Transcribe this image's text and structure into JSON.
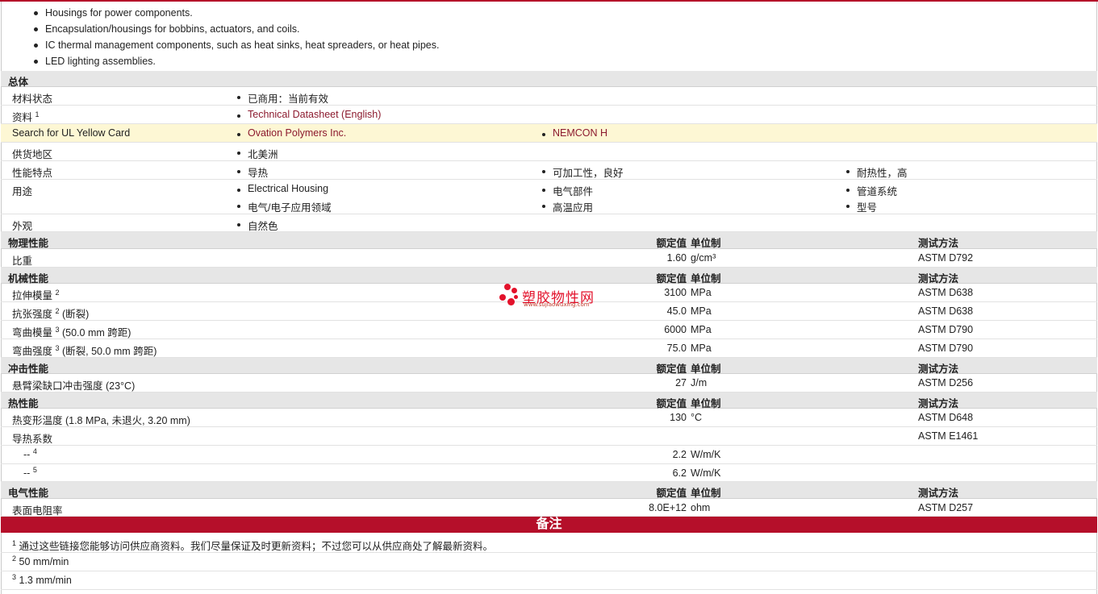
{
  "applications": [
    "Housings for power components.",
    "Encapsulation/housings for bobbins, actuators, and coils.",
    "IC thermal management components, such as heat sinks, heat spreaders, or heat pipes.",
    "LED lighting assemblies."
  ],
  "general": {
    "section_title": "总体",
    "material_status_label": "材料状态",
    "material_status_value": "已商用：当前有效",
    "docs_label": "资料",
    "docs_sup": "1",
    "docs_link": "Technical Datasheet (English)",
    "ul_label": "Search for UL Yellow Card",
    "ul_link_1": "Ovation Polymers Inc.",
    "ul_link_2": "NEMCON H",
    "region_label": "供货地区",
    "region_value": "北美洲",
    "features_label": "性能特点",
    "features": [
      "导热",
      "可加工性，良好",
      "耐热性，高"
    ],
    "uses_label": "用途",
    "uses_row1": [
      "Electrical Housing",
      "电气部件",
      "管道系统"
    ],
    "uses_row2": [
      "电气/电子应用领域",
      "高温应用",
      "型号"
    ],
    "appearance_label": "外观",
    "appearance_value": "自然色"
  },
  "col_headers": {
    "value": "额定值",
    "unit": "单位制",
    "method": "测试方法"
  },
  "physical": {
    "title": "物理性能",
    "rows": [
      {
        "name": "比重",
        "value": "1.60",
        "unit": "g/cm³",
        "method": "ASTM D792"
      }
    ]
  },
  "mechanical": {
    "title": "机械性能",
    "rows": [
      {
        "name": "拉伸模量",
        "sup": "2",
        "suffix": "",
        "value": "3100",
        "unit": "MPa",
        "method": "ASTM D638"
      },
      {
        "name": "抗张强度",
        "sup": "2",
        "suffix": " (断裂)",
        "value": "45.0",
        "unit": "MPa",
        "method": "ASTM D638"
      },
      {
        "name": "弯曲模量",
        "sup": "3",
        "suffix": " (50.0 mm 跨距)",
        "value": "6000",
        "unit": "MPa",
        "method": "ASTM D790"
      },
      {
        "name": "弯曲强度",
        "sup": "3",
        "suffix": " (断裂, 50.0 mm 跨距)",
        "value": "75.0",
        "unit": "MPa",
        "method": "ASTM D790"
      }
    ]
  },
  "impact": {
    "title": "冲击性能",
    "rows": [
      {
        "name": "悬臂梁缺口冲击强度 (23°C)",
        "value": "27",
        "unit": "J/m",
        "method": "ASTM D256"
      }
    ]
  },
  "thermal": {
    "title": "热性能",
    "hdt": {
      "name": "热变形温度 (1.8 MPa, 未退火, 3.20 mm)",
      "value": "130",
      "unit": "°C",
      "method": "ASTM D648"
    },
    "tc": {
      "name": "导热系数",
      "method": "ASTM E1461"
    },
    "tc_sub": [
      {
        "name": "--",
        "sup": "4",
        "value": "2.2",
        "unit": "W/m/K"
      },
      {
        "name": "--",
        "sup": "5",
        "value": "6.2",
        "unit": "W/m/K"
      }
    ]
  },
  "electrical": {
    "title": "电气性能",
    "rows": [
      {
        "name": "表面电阻率",
        "value": "8.0E+12",
        "unit": "ohm",
        "method": "ASTM D257"
      }
    ]
  },
  "notes": {
    "title": "备注",
    "items": [
      {
        "sup": "1",
        "text": "通过这些链接您能够访问供应商资料。我们尽量保证及时更新资料；不过您可以从供应商处了解最新资料。"
      },
      {
        "sup": "2",
        "text": "50 mm/min"
      },
      {
        "sup": "3",
        "text": "1.3 mm/min"
      }
    ]
  },
  "watermark": {
    "name": "塑胶物性网",
    "url": "www.sujiaowuxing.com"
  },
  "colors": {
    "accent": "#b50f2a",
    "link": "#8c1a2e",
    "header_bg": "#e6e6e6",
    "highlight_bg": "#fdf7d4"
  }
}
